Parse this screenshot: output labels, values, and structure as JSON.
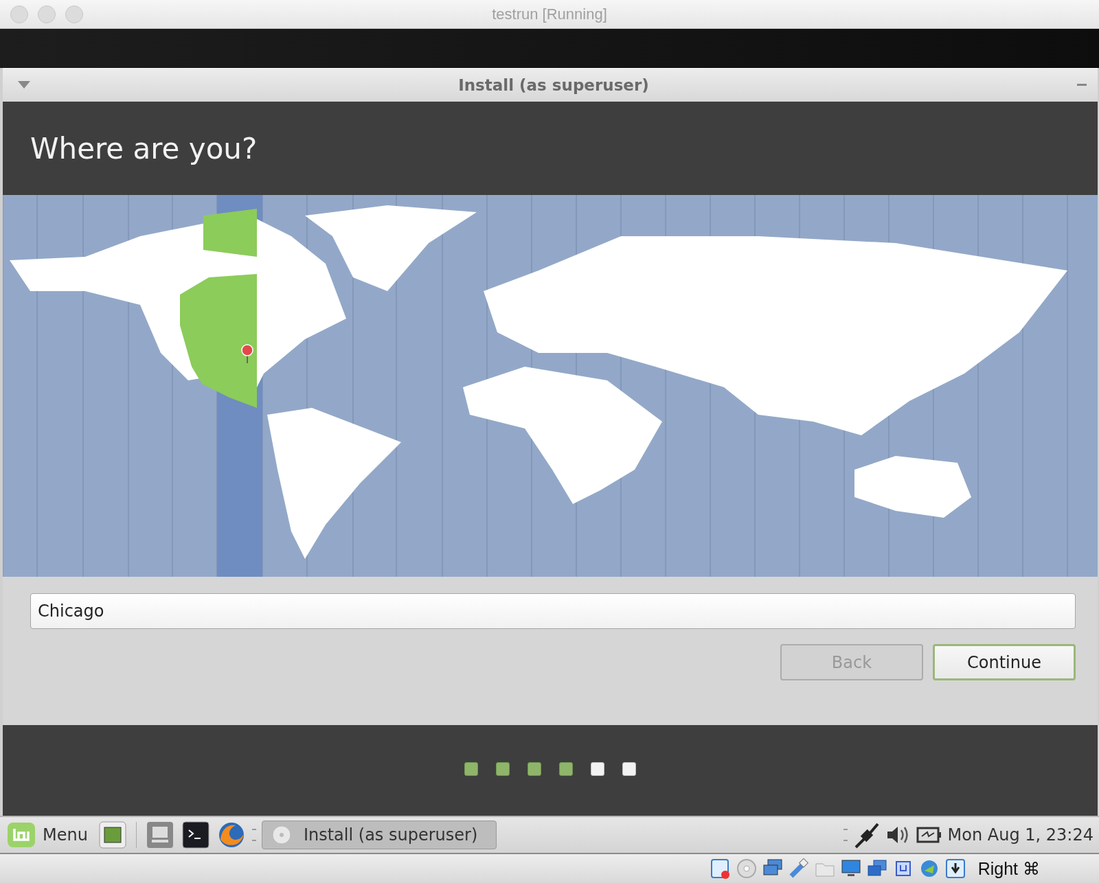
{
  "host_window": {
    "title": "testrun [Running]"
  },
  "installer": {
    "title": "Install (as superuser)",
    "heading": "Where are you?",
    "location_field": {
      "value": "Chicago"
    },
    "buttons": [
      {
        "label": "Back",
        "disabled": true,
        "default": false
      },
      {
        "label": "Continue",
        "disabled": false,
        "default": true
      }
    ],
    "steps": [
      {
        "done": true
      },
      {
        "done": true
      },
      {
        "done": true
      },
      {
        "done": true
      },
      {
        "done": false
      },
      {
        "done": false
      }
    ]
  },
  "taskbar": {
    "menu_label": "Menu",
    "window_button": "Install (as superuser)",
    "clock": "Mon Aug  1, 23:24"
  },
  "vm_status_bar": {
    "host_key": "Right ⌘"
  }
}
